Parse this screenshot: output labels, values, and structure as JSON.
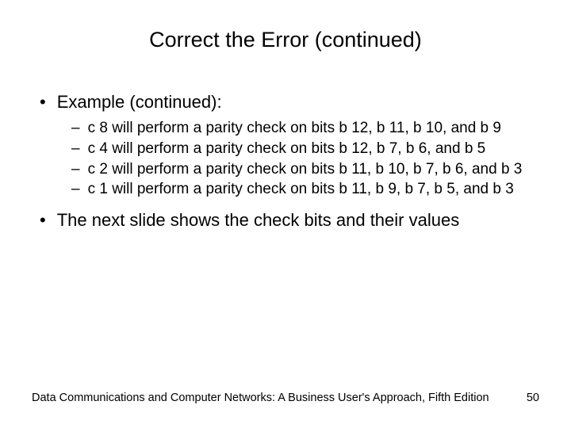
{
  "title": "Correct the Error (continued)",
  "bullets": {
    "b1": "Example (continued):",
    "b2": "The next slide shows the check bits and their values"
  },
  "sub": {
    "s1": "c 8 will perform a parity check on bits b 12, b 11, b 10, and b 9",
    "s2": "c 4 will perform a parity check on bits b 12, b 7, b 6, and b 5",
    "s3": "c 2 will perform a parity check on bits b 11, b 10, b 7, b 6, and b 3",
    "s4": "c 1 will perform a parity check on bits b 11, b 9, b 7, b 5, and b 3"
  },
  "footer": {
    "text": "Data Communications and Computer Networks: A Business User's Approach, Fifth Edition",
    "page": "50"
  }
}
